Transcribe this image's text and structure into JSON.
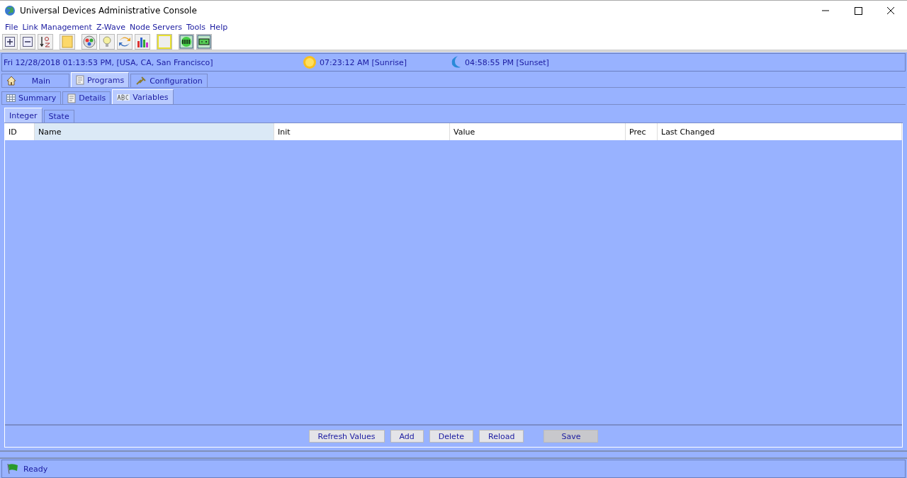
{
  "window": {
    "title": "Universal Devices Administrative Console"
  },
  "menu": [
    "File",
    "Link Management",
    "Z-Wave",
    "Node Servers",
    "Tools",
    "Help"
  ],
  "info_bar": {
    "datetime": "Fri 12/28/2018 01:13:53 PM,  [USA, CA, San Francisco]",
    "sunrise": "07:23:12 AM [Sunrise]",
    "sunset": "04:58:55 PM [Sunset]"
  },
  "main_tabs": [
    {
      "label": "Main",
      "kind": "home",
      "selected": false
    },
    {
      "label": "Programs",
      "kind": "doc",
      "selected": true
    },
    {
      "label": "Configuration",
      "kind": "link",
      "selected": false
    }
  ],
  "program_tabs": [
    {
      "label": "Summary",
      "kind": "grid",
      "selected": false
    },
    {
      "label": "Details",
      "kind": "doc",
      "selected": false
    },
    {
      "label": "Variables",
      "kind": "abc",
      "selected": true
    }
  ],
  "variable_tabs": [
    {
      "label": "Integer",
      "selected": true
    },
    {
      "label": "State",
      "selected": false
    }
  ],
  "table": {
    "columns": [
      {
        "label": "ID",
        "highlighted": false
      },
      {
        "label": "Name",
        "highlighted": true
      },
      {
        "label": "Init",
        "highlighted": false
      },
      {
        "label": "Value",
        "highlighted": false
      },
      {
        "label": "Prec",
        "highlighted": false
      },
      {
        "label": "Last Changed",
        "highlighted": false
      }
    ]
  },
  "buttons": [
    {
      "label": "Refresh Values",
      "disabled": false
    },
    {
      "label": "Add",
      "disabled": false
    },
    {
      "label": "Delete",
      "disabled": false
    },
    {
      "label": "Reload",
      "disabled": false
    },
    {
      "label": "Save",
      "disabled": true
    }
  ],
  "status_bar": {
    "text": "Ready"
  }
}
